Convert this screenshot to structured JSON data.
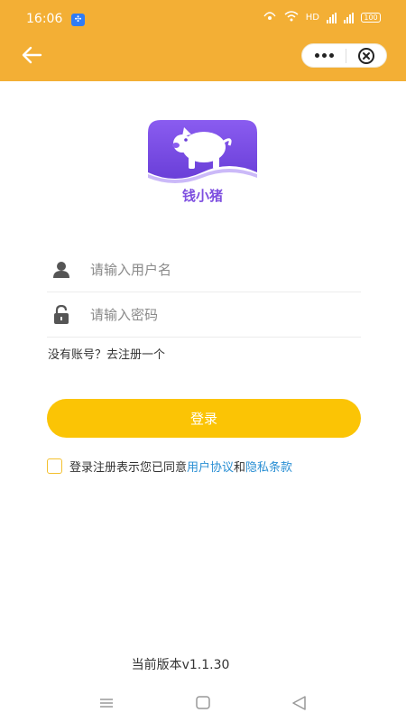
{
  "status": {
    "time": "16:06",
    "network": "HD",
    "battery": "100"
  },
  "header": {
    "back_icon": "arrow-left-icon",
    "more_icon": "more-dots-icon",
    "close_icon": "close-circle-icon"
  },
  "logo": {
    "text": "钱小猪",
    "icon": "pig-logo-icon",
    "color": "#7e4fe0"
  },
  "form": {
    "username_placeholder": "请输入用户名",
    "password_placeholder": "请输入密码",
    "register_link": "没有账号？去注册一个",
    "login_button": "登录"
  },
  "agreement": {
    "prefix": "登录注册表示您已同意",
    "user_agreement": "用户协议",
    "conjunction": "和",
    "privacy_policy": "隐私条款"
  },
  "footer": {
    "version": "当前版本v1.1.30"
  },
  "colors": {
    "header": "#f3af35",
    "button": "#fbc405",
    "link": "#2a8fd4"
  }
}
